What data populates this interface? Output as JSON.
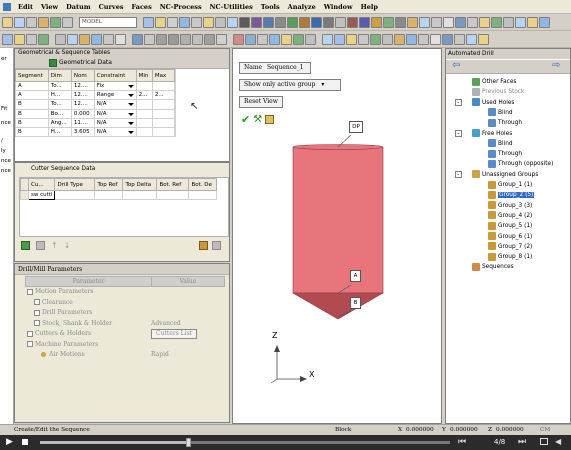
{
  "menubar": {
    "items": [
      "Edit",
      "View",
      "Datum",
      "Curves",
      "Faces",
      "NC-Process",
      "NC-Utilities",
      "Tools",
      "Analyze",
      "Window",
      "Help"
    ]
  },
  "toolbar": {
    "model_select": "MODEL"
  },
  "left_strip": {
    "lines": [
      "er",
      "Fit",
      "nce",
      "/",
      "ly",
      "nce",
      "nce"
    ]
  },
  "geo_panel": {
    "title": "Geometrical & Sequence Tables",
    "sub_title": "Geometrical Data",
    "columns": [
      "Segment",
      "Dim",
      "Nom",
      "Constraint",
      "Min",
      "Max"
    ],
    "rows": [
      {
        "segment": "A",
        "dim": "To...",
        "nom": "12....",
        "constraint": "Fix",
        "min": "",
        "max": ""
      },
      {
        "segment": "A",
        "dim": "H...",
        "nom": "12....",
        "constraint": "Range",
        "min": "2...",
        "max": "2..."
      },
      {
        "segment": "B",
        "dim": "To...",
        "nom": "12....",
        "constraint": "N/A",
        "min": "",
        "max": ""
      },
      {
        "segment": "B",
        "dim": "Bo...",
        "nom": "0.000",
        "constraint": "N/A",
        "min": "",
        "max": ""
      },
      {
        "segment": "B",
        "dim": "Ang...",
        "nom": "11....",
        "constraint": "N/A",
        "min": "",
        "max": ""
      },
      {
        "segment": "B",
        "dim": "H...",
        "nom": "3.605",
        "constraint": "N/A",
        "min": "",
        "max": ""
      }
    ]
  },
  "cutter_panel": {
    "title": "Cutter Sequence Data",
    "columns": [
      "Cu...",
      "Drill Type",
      "Top Ref",
      "Top Delta",
      "Bot. Ref",
      "Bot. De"
    ],
    "rows": [
      {
        "cutter": "sw cutti",
        "drill_type": "",
        "top_ref": "",
        "top_delta": "",
        "bot_ref": "",
        "bot_delta": ""
      }
    ]
  },
  "drill_panel": {
    "title": "Drill/Mill Parameters",
    "columns": [
      "Parameter",
      "Value"
    ],
    "rows": [
      {
        "label": "Motion Parameters",
        "value": "",
        "indent": 1
      },
      {
        "label": "Clearance",
        "value": "",
        "indent": 2
      },
      {
        "label": "Drill Parameters",
        "value": "",
        "indent": 2
      },
      {
        "label": "Stock, Shank & Holder",
        "value": "Advanced",
        "indent": 2
      },
      {
        "label": "Cutters & Holders",
        "value": "Cutters List",
        "indent": 1
      },
      {
        "label": "Machine Parameters",
        "value": "",
        "indent": 1
      },
      {
        "label": "Air Motions",
        "value": "Rapid",
        "indent": 3
      }
    ]
  },
  "sequence_window": {
    "name_label": "Name",
    "name_value": "Sequence_1",
    "show_select": "Show only active group",
    "reset_view": "Reset View",
    "labels": {
      "top": "DP",
      "mid": "A",
      "bottom": "B"
    },
    "axis_z": "Z",
    "axis_x": "X"
  },
  "tree": {
    "title": "Automated Drill",
    "items": [
      {
        "label": "Other Faces",
        "level": 1,
        "icon": "faces-icon",
        "expander": "",
        "selected": false,
        "grey": false
      },
      {
        "label": "Previous Stock",
        "level": 1,
        "icon": "stock-icon",
        "expander": "",
        "selected": false,
        "grey": true
      },
      {
        "label": "Used Holes",
        "level": 1,
        "icon": "used-holes-icon",
        "expander": "-",
        "selected": false,
        "grey": false
      },
      {
        "label": "Blind",
        "level": 2,
        "icon": "hole-icon",
        "expander": "",
        "selected": false,
        "grey": false
      },
      {
        "label": "Through",
        "level": 2,
        "icon": "hole-icon",
        "expander": "",
        "selected": false,
        "grey": false
      },
      {
        "label": "Free Holes",
        "level": 1,
        "icon": "free-holes-icon",
        "expander": "-",
        "selected": false,
        "grey": false
      },
      {
        "label": "Blind",
        "level": 2,
        "icon": "hole-icon",
        "expander": "",
        "selected": false,
        "grey": false
      },
      {
        "label": "Through",
        "level": 2,
        "icon": "hole-icon",
        "expander": "",
        "selected": false,
        "grey": false
      },
      {
        "label": "Through (opposite)",
        "level": 2,
        "icon": "hole-icon",
        "expander": "",
        "selected": false,
        "grey": false
      },
      {
        "label": "Unassigned Groups",
        "level": 1,
        "icon": "group-folder-icon",
        "expander": "-",
        "selected": false,
        "grey": false
      },
      {
        "label": "Group_1 (1)",
        "level": 2,
        "icon": "group-icon",
        "expander": "",
        "selected": false,
        "grey": false
      },
      {
        "label": "Group_2 (5)",
        "level": 2,
        "icon": "group-icon",
        "expander": "",
        "selected": true,
        "grey": false
      },
      {
        "label": "Group_3 (3)",
        "level": 2,
        "icon": "group-icon",
        "expander": "",
        "selected": false,
        "grey": false
      },
      {
        "label": "Group_4 (2)",
        "level": 2,
        "icon": "group-icon",
        "expander": "",
        "selected": false,
        "grey": false
      },
      {
        "label": "Group_5 (1)",
        "level": 2,
        "icon": "group-icon",
        "expander": "",
        "selected": false,
        "grey": false
      },
      {
        "label": "Group_6 (1)",
        "level": 2,
        "icon": "group-icon",
        "expander": "",
        "selected": false,
        "grey": false
      },
      {
        "label": "Group_7 (2)",
        "level": 2,
        "icon": "group-icon",
        "expander": "",
        "selected": false,
        "grey": false
      },
      {
        "label": "Group_8 (1)",
        "level": 2,
        "icon": "group-icon",
        "expander": "",
        "selected": false,
        "grey": false
      },
      {
        "label": "Sequences",
        "level": 1,
        "icon": "sequences-icon",
        "expander": "",
        "selected": false,
        "grey": false
      }
    ]
  },
  "statusbar": {
    "message": "Create/Edit the Sequence",
    "mode": "Block",
    "x_label": "X",
    "x_value": "0.000000",
    "y_label": "Y",
    "y_value": "0.000000",
    "z_label": "Z",
    "z_value": "0.000000",
    "unit": "CM"
  },
  "player": {
    "page": "4/8",
    "progress": 0.36
  },
  "colors": {
    "drill_body": "#e8747c",
    "drill_tip": "#b24a52",
    "drill_outline": "#8a3a40",
    "selection": "#316ac5",
    "check_green": "#1f9a1f"
  }
}
